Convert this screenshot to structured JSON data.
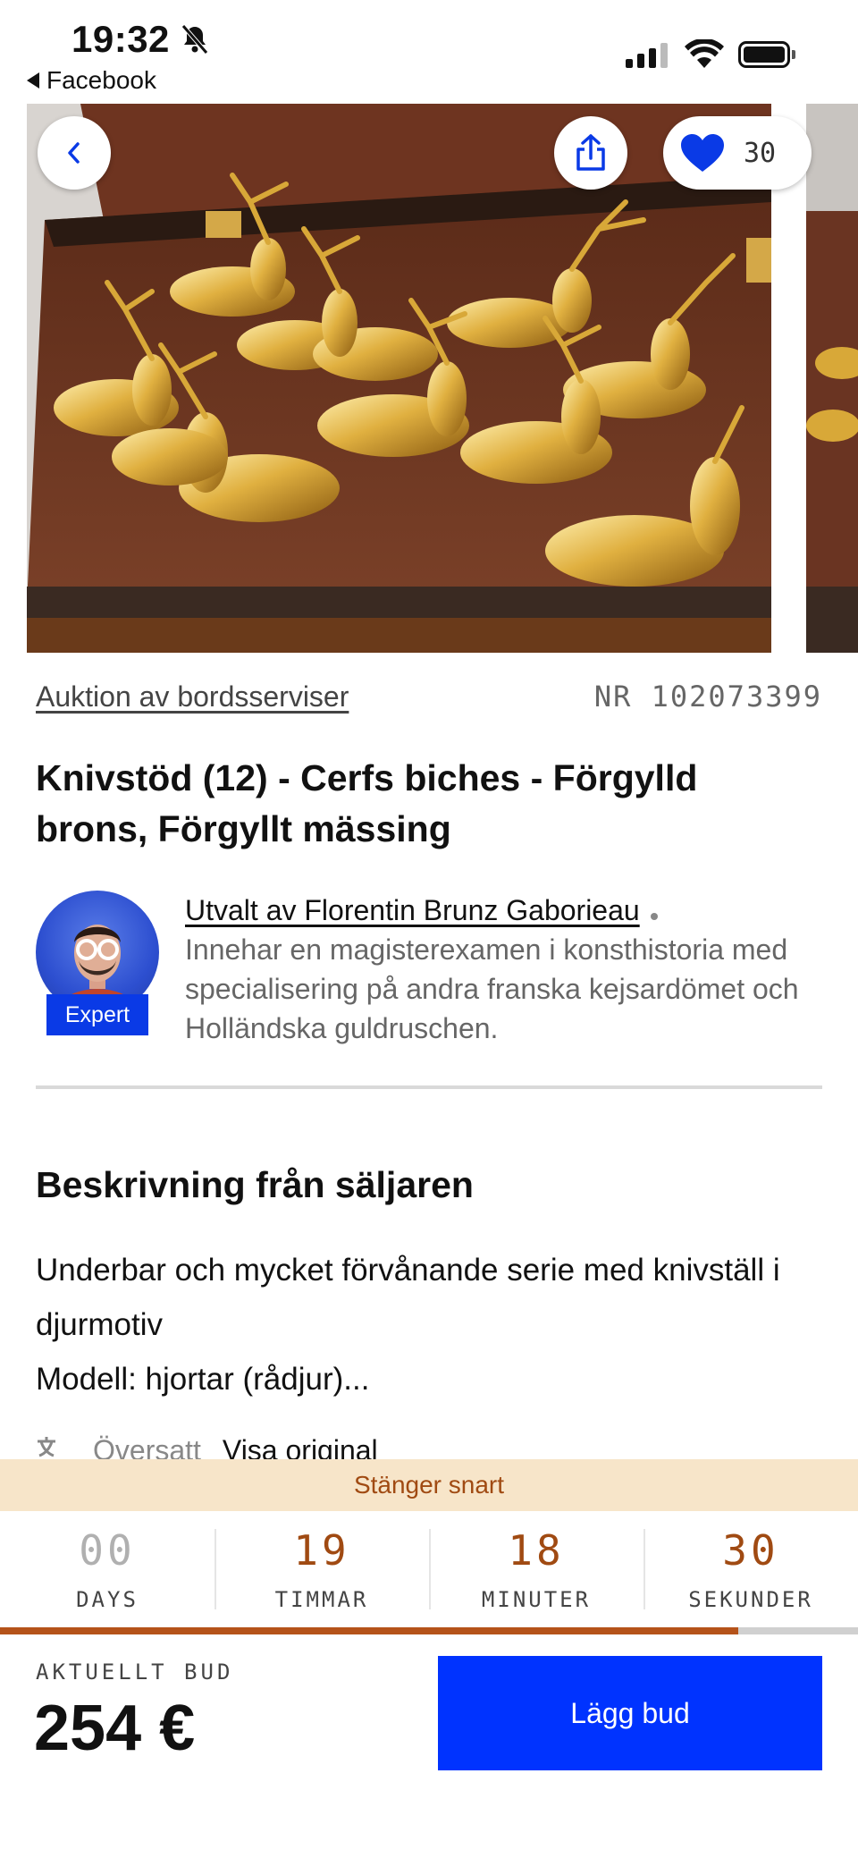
{
  "status_bar": {
    "time": "19:32",
    "back_app": "Facebook"
  },
  "gallery": {
    "favorite_count": "30",
    "icons": [
      "chevron-left-icon",
      "share-icon",
      "heart-icon"
    ],
    "heart_color": "#0a3ae6"
  },
  "lot": {
    "category": "Auktion av bordsserviser",
    "number": "NR 102073399",
    "title": "Knivstöd (12) - Cerfs biches - Förgylld brons, Förgyllt mässing"
  },
  "expert": {
    "name": "Utvalt av Florentin Brunz Gaborieau",
    "bio": "Innehar en magisterexamen i konsthistoria med specialisering på andra franska kejsardömet och Holländska guldruschen.",
    "badge": "Expert"
  },
  "description": {
    "heading": "Beskrivning från säljaren",
    "line1": "Underbar och mycket förvånande serie med knivställ i djurmotiv",
    "line2": "Modell: hjortar (rådjur)...",
    "translated": "Översatt",
    "show_original": "Visa original"
  },
  "auction": {
    "closing_text": "Stänger snart",
    "days_value": "00",
    "days_label": "DAYS",
    "hours_value": "19",
    "hours_label": "TIMMAR",
    "minutes_value": "18",
    "minutes_label": "MINUTER",
    "seconds_value": "30",
    "seconds_label": "SEKUNDER",
    "progress_percent": 86,
    "current_bid_label": "AKTUELLT BUD",
    "current_bid": "254 €",
    "bid_button": "Lägg bud",
    "accent_color": "#0033ff",
    "closing_color": "#a04a12"
  }
}
